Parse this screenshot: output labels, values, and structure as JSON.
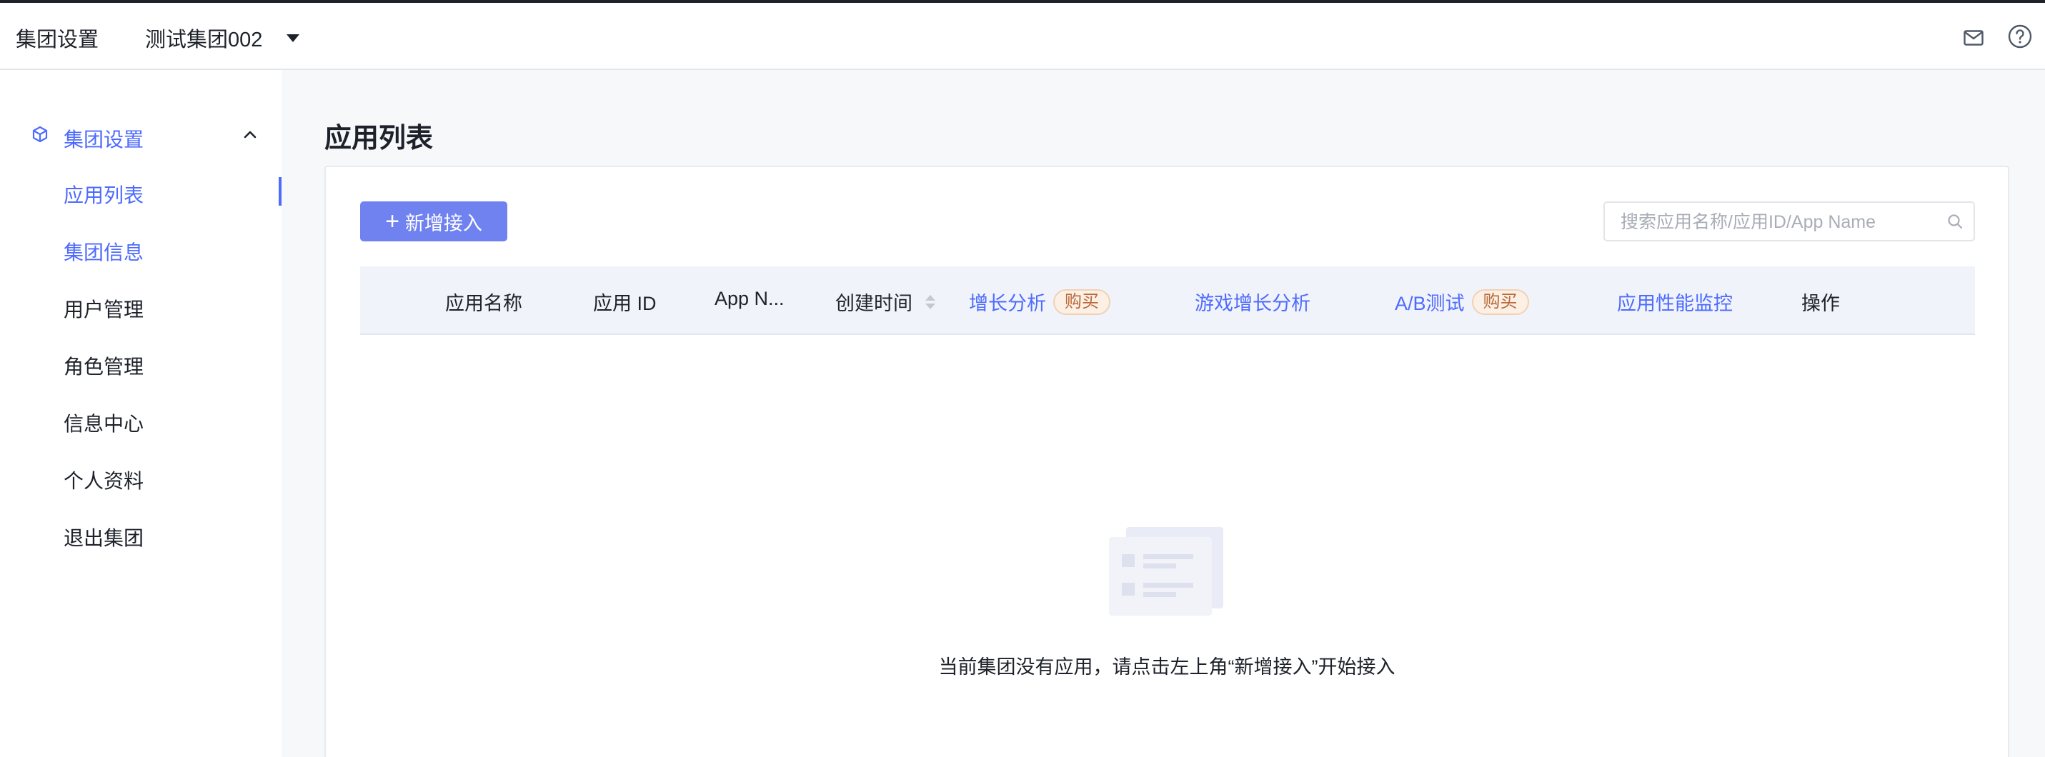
{
  "header": {
    "title": "集团设置",
    "group_name": "测试集团002",
    "icons": [
      "mail-icon",
      "help-icon",
      "caret-down-icon"
    ]
  },
  "sidebar": {
    "group_label": "集团设置",
    "items": [
      {
        "label": "应用列表",
        "active": true
      },
      {
        "label": "集团信息"
      },
      {
        "label": "用户管理"
      },
      {
        "label": "角色管理"
      },
      {
        "label": "信息中心"
      },
      {
        "label": "个人资料"
      },
      {
        "label": "退出集团"
      }
    ]
  },
  "main": {
    "page_title": "应用列表",
    "add_button": "新增接入",
    "search_placeholder": "搜索应用名称/应用ID/App Name",
    "columns": {
      "app_name": "应用名称",
      "app_id": "应用 ID",
      "app_n": "App N...",
      "created_time": "创建时间",
      "growth": "增长分析",
      "growth_badge": "购买",
      "game_growth": "游戏增长分析",
      "ab_test": "A/B测试",
      "ab_badge": "购买",
      "apm": "应用性能监控",
      "actions": "操作"
    },
    "empty_message": "当前集团没有应用，请点击左上角“新增接入”开始接入"
  },
  "colors": {
    "accent": "#4d6bfe",
    "button": "#6f82f0",
    "badge_text": "#b86a3a",
    "badge_bg": "#fcefe4"
  }
}
